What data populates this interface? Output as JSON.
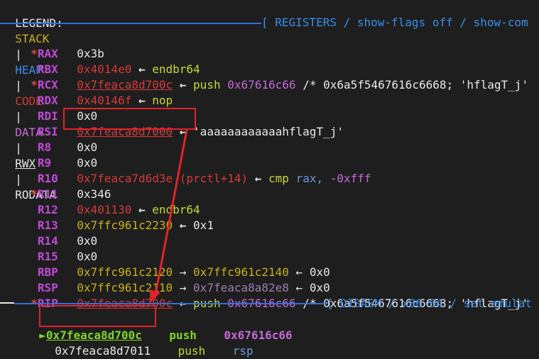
{
  "legend": {
    "label": "LEGEND:",
    "items": [
      "STACK",
      "HEAP",
      "CODE",
      "DATA",
      "RWX",
      "RODATA"
    ],
    "sep": "|"
  },
  "registers_header": "[ REGISTERS / show-flags off / show-com",
  "registers": [
    {
      "star": "*",
      "name": "RAX",
      "value": "0x3b",
      "rest": ""
    },
    {
      "star": "",
      "name": "RBX",
      "value": "0x4014e0",
      "arrow": "←",
      "rest": "endbr64"
    },
    {
      "star": "*",
      "name": "RCX",
      "value": "0x7feaca8d700c",
      "arrow": "←",
      "op": "push",
      "arg": "0x67616c66",
      "comment": "/* 0x6a5f5467616c6668; 'hflagT_j'"
    },
    {
      "star": "",
      "name": "RDX",
      "value": "0x40146f",
      "arrow": "←",
      "rest": "nop"
    },
    {
      "star": "",
      "name": "RDI",
      "value": "0x0"
    },
    {
      "star": "",
      "name": "RSI",
      "value": "0x7feaca8d7000",
      "arrow": "←",
      "rest": "'aaaaaaaaaaaahflagT_j'"
    },
    {
      "star": "",
      "name": "R8",
      "value": "0x0"
    },
    {
      "star": "",
      "name": "R9",
      "value": "0x0"
    },
    {
      "star": "",
      "name": "R10",
      "value": "0x7feaca7d6d3e",
      "sym": "(prctl+14)",
      "arrow": "←",
      "op": "cmp",
      "arg": "rax,",
      "arg2": "-0xfff"
    },
    {
      "star": "*",
      "name": "R11",
      "value": "0x346"
    },
    {
      "star": "",
      "name": "R12",
      "value": "0x401130",
      "arrow": "←",
      "rest": "endbr64"
    },
    {
      "star": "",
      "name": "R13",
      "value": "0x7ffc961c2230",
      "arrow": "←",
      "rest": "0x1"
    },
    {
      "star": "",
      "name": "R14",
      "value": "0x0"
    },
    {
      "star": "",
      "name": "R15",
      "value": "0x0"
    },
    {
      "star": "",
      "name": "RBP",
      "value": "0x7ffc961c2120",
      "arrow": "→",
      "v2": "0x7ffc961c2140",
      "arrow2": "←",
      "v3": "0x0"
    },
    {
      "star": "",
      "name": "RSP",
      "value": "0x7ffc961c2110",
      "arrow": "→",
      "v2": "0x7feaca8a82e8",
      "arrow2": "←",
      "v3": "0x0"
    },
    {
      "star": "*",
      "name": "RIP",
      "value": "0x7feaca8d700c",
      "arrow": "←",
      "op": "push",
      "arg": "0x67616c66",
      "comment": "/* 0x6a5f5467616c6668; 'hflagT_j'"
    }
  ],
  "disasm_header": "[ DISASM / x86-64 / set emulat",
  "disasm": [
    {
      "marker": "►",
      "addr": "0x7feaca8d700c",
      "op": "push",
      "arg": "0x67616c66"
    },
    {
      "marker": "",
      "addr": "0x7feaca8d7011",
      "op": "push",
      "arg": "rsp"
    }
  ],
  "colors": {
    "accent_box": "#e0232a",
    "stack": "#c9b320",
    "heap": "#3b8eea",
    "code": "#d63a3a",
    "data": "#c46ad6"
  }
}
